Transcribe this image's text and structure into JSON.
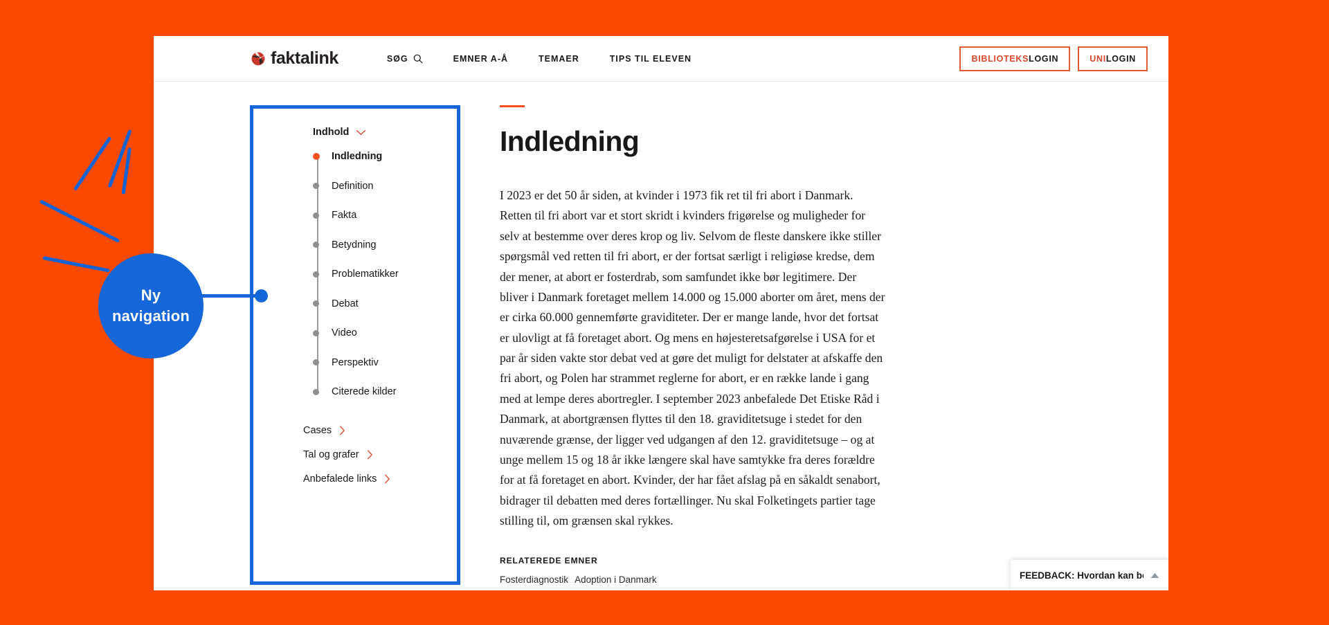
{
  "background_color": "#FB4900",
  "annotation": {
    "bubble_line1": "Ny",
    "bubble_line2": "navigation",
    "bubble_color": "#1566D8",
    "spark_color": "#1264D6"
  },
  "header": {
    "logo_text": "faktalink",
    "logo_icon": "faktalink-swirl-icon",
    "nav": [
      {
        "label": "SØG",
        "icon": "search-icon"
      },
      {
        "label": "EMNER A-Å",
        "icon": ""
      },
      {
        "label": "TEMAER",
        "icon": ""
      },
      {
        "label": "TIPS TIL ELEVEN",
        "icon": ""
      }
    ],
    "auth": [
      {
        "accent": "BIBLIOTEKS",
        "rest": "LOGIN"
      },
      {
        "accent": "UNI",
        "rest": "LOGIN"
      }
    ],
    "accent_color": "#D9472A"
  },
  "toc": {
    "title": "Indhold",
    "toggle_icon": "chevron-down-icon",
    "active_dot_color": "#F4511E",
    "border_color": "#1566D8",
    "items": [
      {
        "label": "Indledning",
        "active": true
      },
      {
        "label": "Definition",
        "active": false
      },
      {
        "label": "Fakta",
        "active": false
      },
      {
        "label": "Betydning",
        "active": false
      },
      {
        "label": "Problematikker",
        "active": false
      },
      {
        "label": "Debat",
        "active": false
      },
      {
        "label": "Video",
        "active": false
      },
      {
        "label": "Perspektiv",
        "active": false
      },
      {
        "label": "Citerede kilder",
        "active": false
      }
    ],
    "extra": [
      {
        "label": "Cases",
        "icon": "chevron-right-icon"
      },
      {
        "label": "Tal og grafer",
        "icon": "chevron-right-icon"
      },
      {
        "label": "Anbefalede links",
        "icon": "chevron-right-icon"
      }
    ]
  },
  "article": {
    "rule_color": "#F4511E",
    "title": "Indledning",
    "body": "I 2023 er det 50 år siden, at kvinder i 1973 fik ret til fri abort i Danmark. Retten til fri abort var et stort skridt i kvinders frigørelse og muligheder for selv at bestemme over deres krop og liv. Selvom de fleste danskere ikke stiller spørgsmål ved retten til fri abort, er der fortsat særligt i religiøse kredse, dem der mener, at abort er fosterdrab, som samfundet ikke bør legitimere. Der bliver i Danmark foretaget mellem 14.000 og 15.000 aborter om året, mens der er cirka 60.000 gennemførte graviditeter. Der er mange lande, hvor det fortsat er ulovligt at få foretaget abort. Og mens en højesteretsafgørelse i USA for et par år siden vakte stor debat ved at gøre det muligt for delstater at afskaffe den fri abort, og Polen har strammet reglerne for abort, er en række lande i gang med at lempe deres abortregler. I september 2023 anbefalede Det Etiske Råd i Danmark, at abortgrænsen flyttes til den 18. graviditetsuge i stedet for den nuværende grænse, der ligger ved udgangen af den 12. graviditetsuge – og at unge mellem 15 og 18 år ikke længere skal have samtykke fra deres forældre for at få foretaget en abort. Kvinder, der har fået afslag på en såkaldt senabort, bidrager til debatten med deres fortællinger. Nu skal Folketingets partier tage stilling til, om grænsen skal rykkes.",
    "related_heading": "RELATEREDE EMNER",
    "related_tags": [
      "Fosterdiagnostik",
      "Adoption i Danmark"
    ]
  },
  "feedback": {
    "text": "FEEDBACK: Hvordan kan beta....",
    "icon": "triangle-up-icon"
  }
}
